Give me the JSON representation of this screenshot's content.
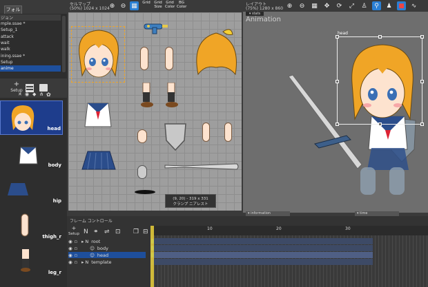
{
  "folder_panel": {
    "tab": "フォルダ",
    "header": "ジョン",
    "files": [
      "mple.ssae *",
      "Setup_1",
      "attack",
      "wait",
      "walk",
      "ining.ssae *",
      "Setup",
      "anime"
    ]
  },
  "parts_panel": {
    "setup_label": "Setup",
    "parts": [
      {
        "name": "head"
      },
      {
        "name": "body"
      },
      {
        "name": "hip"
      },
      {
        "name": "thigh_r"
      },
      {
        "name": "leg_r"
      }
    ]
  },
  "cellmap": {
    "title": "セルマップ",
    "size": "(50%) 1024 x 1024",
    "toolbar": [
      "Grid",
      "Grid Size",
      "Grid Color",
      "BG Color"
    ],
    "status_coords": "(9, 20) - 319 x 331",
    "status_mode": "クランプ  ニアレスト"
  },
  "layout": {
    "title": "レイアウト",
    "size": "(75%) 1280 x 860",
    "stats": "stats",
    "watermark": "Animation",
    "selected_part": "head",
    "info_tab": "information",
    "time_tab": "time"
  },
  "timeline": {
    "title": "フレーム コントロール",
    "setup_label": "Setup",
    "ticks": [
      "10",
      "20",
      "30"
    ],
    "rows": [
      {
        "name": "root",
        "indent": 0
      },
      {
        "name": "body",
        "indent": 1
      },
      {
        "name": "head",
        "indent": 1
      },
      {
        "name": "template",
        "indent": 0
      }
    ]
  },
  "colors": {
    "accent": "#1e4f9c",
    "hair": "#f0a526",
    "skirt": "#2b4d8b"
  }
}
